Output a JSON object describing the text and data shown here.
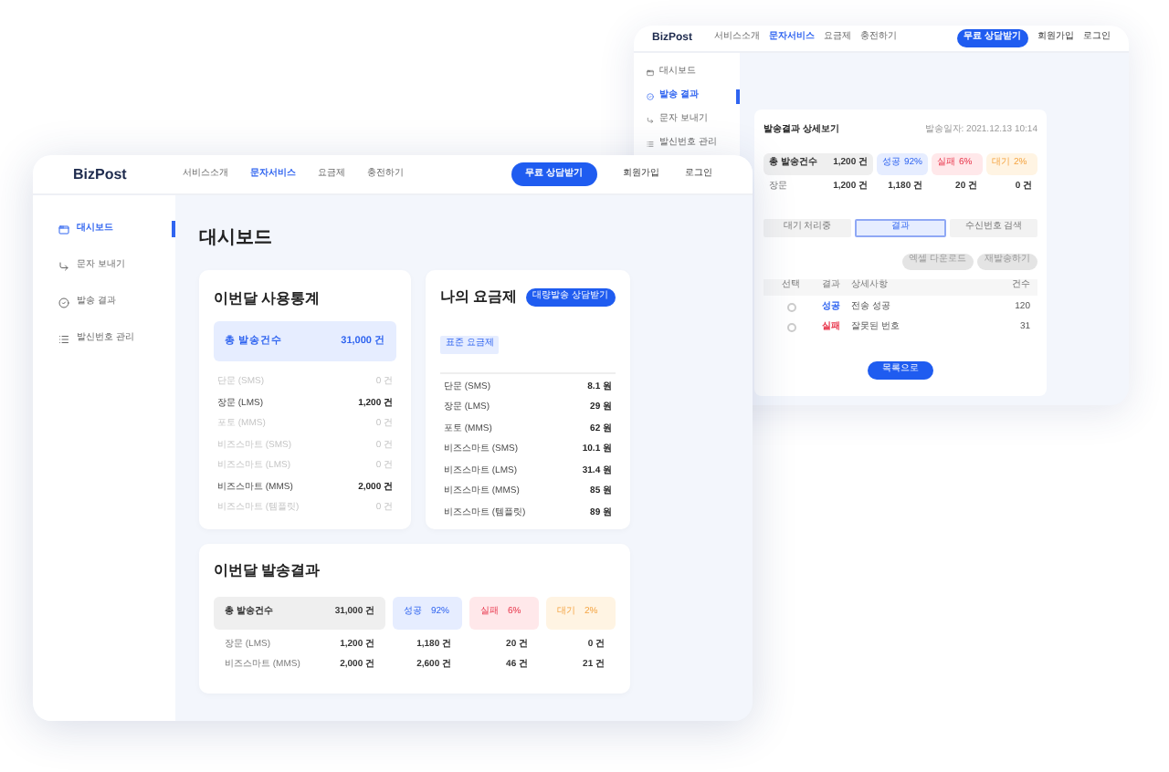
{
  "back_window": {
    "header": {
      "logo": "BizPost",
      "nav": [
        {
          "label": "서비스소개",
          "selected": false
        },
        {
          "label": "문자서비스",
          "selected": true
        },
        {
          "label": "요금제",
          "selected": false
        },
        {
          "label": "충전하기",
          "selected": false
        }
      ],
      "cta": "무료 상담받기",
      "links": [
        "회원가입",
        "로그인"
      ]
    },
    "sidebar": [
      {
        "label": "대시보드",
        "selected": false
      },
      {
        "label": "발송 결과",
        "selected": true
      },
      {
        "label": "문자 보내기",
        "selected": false
      },
      {
        "label": "발신번호 관리",
        "selected": false
      }
    ],
    "detail": {
      "title": "발송결과 상세보기",
      "date": "발송일자: 2021.12.13 10:14",
      "total_label": "총 발송건수",
      "total_value": "1,200 건",
      "stats": [
        {
          "label": "성공",
          "value": "92%",
          "kind": "success"
        },
        {
          "label": "실패",
          "value": "6%",
          "kind": "fail"
        },
        {
          "label": "대기",
          "value": "2%",
          "kind": "wait"
        }
      ],
      "row": {
        "label": "장문",
        "values": [
          "1,200 건",
          "1,180 건",
          "20 건",
          "0 건"
        ]
      },
      "tabs": [
        {
          "label": "대기 처리중",
          "selected": false
        },
        {
          "label": "결과",
          "selected": true
        },
        {
          "label": "수신번호 검색",
          "selected": false
        }
      ],
      "actions": [
        "엑셀 다운로드",
        "재발송하기"
      ],
      "columns": [
        "선택",
        "결과",
        "상세사항",
        "건수"
      ],
      "rows": [
        {
          "result": "성공",
          "kind": "success",
          "detail": "전송 성공",
          "count": "120",
          "selected": false
        },
        {
          "result": "실패",
          "kind": "fail",
          "detail": "잘못된 번호",
          "count": "31",
          "selected": false
        }
      ],
      "button": "목록으로"
    }
  },
  "front_window": {
    "header": {
      "logo": "BizPost",
      "nav": [
        {
          "label": "서비스소개",
          "selected": false
        },
        {
          "label": "문자서비스",
          "selected": true
        },
        {
          "label": "요금제",
          "selected": false
        },
        {
          "label": "충전하기",
          "selected": false
        }
      ],
      "cta": "무료 상담받기",
      "links": [
        "회원가입",
        "로그인"
      ]
    },
    "sidebar": [
      {
        "label": "대시보드",
        "selected": true
      },
      {
        "label": "문자 보내기",
        "selected": false
      },
      {
        "label": "발송 결과",
        "selected": false
      },
      {
        "label": "발신번호 관리",
        "selected": false
      }
    ],
    "title": "대시보드",
    "usage": {
      "title": "이번달 사용통계",
      "total_label": "총 발송건수",
      "total_value": "31,000 건",
      "rows": [
        {
          "label": "단문 (SMS)",
          "value": "0 건",
          "dimmed": true
        },
        {
          "label": "장문 (LMS)",
          "value": "1,200 건",
          "dimmed": false
        },
        {
          "label": "포토 (MMS)",
          "value": "0 건",
          "dimmed": true
        },
        {
          "label": "비즈스마트 (SMS)",
          "value": "0 건",
          "dimmed": true
        },
        {
          "label": "비즈스마트 (LMS)",
          "value": "0 건",
          "dimmed": true
        },
        {
          "label": "비즈스마트 (MMS)",
          "value": "2,000 건",
          "dimmed": false
        },
        {
          "label": "비즈스마트 (템플릿)",
          "value": "0 건",
          "dimmed": true
        }
      ]
    },
    "plan": {
      "title": "나의 요금제",
      "button": "대량발송 상담받기",
      "badge": "표준 요금제",
      "rows": [
        {
          "label": "단문 (SMS)",
          "value": "8.1 원"
        },
        {
          "label": "장문 (LMS)",
          "value": "29 원"
        },
        {
          "label": "포토 (MMS)",
          "value": "62 원"
        },
        {
          "label": "비즈스마트 (SMS)",
          "value": "10.1 원"
        },
        {
          "label": "비즈스마트 (LMS)",
          "value": "31.4 원"
        },
        {
          "label": "비즈스마트 (MMS)",
          "value": "85 원"
        },
        {
          "label": "비즈스마트 (템플릿)",
          "value": "89 원"
        }
      ]
    },
    "results": {
      "title": "이번달 발송결과",
      "total_label": "총 발송건수",
      "total_value": "31,000 건",
      "stats": [
        {
          "label": "성공",
          "value": "92%",
          "kind": "success"
        },
        {
          "label": "실패",
          "value": "6%",
          "kind": "fail"
        },
        {
          "label": "대기",
          "value": "2%",
          "kind": "wait"
        }
      ],
      "rows": [
        {
          "label": "장문 (LMS)",
          "values": [
            "1,200 건",
            "1,180 건",
            "20 건",
            "0 건"
          ]
        },
        {
          "label": "비즈스마트 (MMS)",
          "values": [
            "2,000 건",
            "2,600 건",
            "46 건",
            "21 건"
          ]
        }
      ]
    }
  }
}
